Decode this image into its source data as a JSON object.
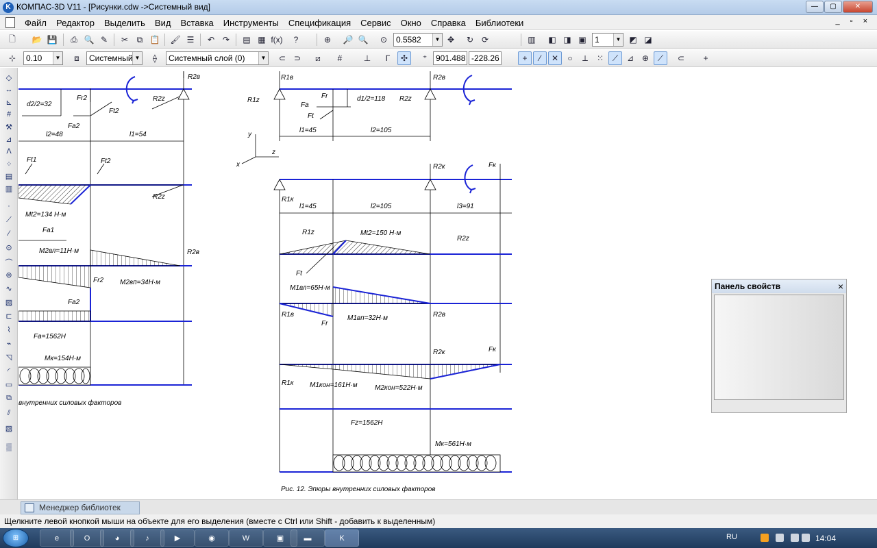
{
  "window": {
    "title": "КОМПАС-3D V11 - [Рисунки.cdw ->Системный вид]",
    "app_icon": "kompas-logo-icon",
    "controls": [
      "minimize-icon",
      "maximize-icon",
      "close-icon"
    ]
  },
  "menu": {
    "items": [
      "Файл",
      "Редактор",
      "Выделить",
      "Вид",
      "Вставка",
      "Инструменты",
      "Спецификация",
      "Сервис",
      "Окно",
      "Справка",
      "Библиотеки"
    ],
    "doc_controls": "_ ▫ ×"
  },
  "toolbar1": {
    "zoom_value": "0.5582",
    "layer_num": "1"
  },
  "toolbar2": {
    "step_value": "0.10",
    "view_select": "Системный",
    "layer_select": "Системный слой (0)",
    "coord_x": "901.488",
    "coord_y": "-228.26"
  },
  "drawing": {
    "caption": "Рис. 12. Эпюры внутренних силовых факторов",
    "caption_left": "внутренних силовых факторов",
    "labels_left": {
      "R2b": "R2в",
      "Fr2": "Fr2",
      "Ft2": "Ft2",
      "R2z": "R2z",
      "d2": "d2/2=32",
      "Fa2": "Fa2",
      "l2": "l2=48",
      "l1": "l1=54",
      "Ft1": "Ft1",
      "Ft2b": "Ft2",
      "R2z2": "R2z",
      "Mt2": "Mt2=134 Н·м",
      "Fa1": "Fa1",
      "M2bl": "M2вл=11Н·м",
      "R2b2": "R2в",
      "Fr2b": "Fr2",
      "M2bp": "M2вп=34Н·м",
      "Fa2b": "Fa2",
      "Fa": "Fa=1562Н",
      "Mk": "Mк=154Н·м"
    },
    "labels_right": {
      "R1b": "R1в",
      "R2b": "R2в",
      "R1z": "R1z",
      "Fr": "Fr",
      "d1": "d1/2=118",
      "Fa": "Fa",
      "R2z": "R2z",
      "Ft": "Ft",
      "l1": "l1=45",
      "l2": "l2=105",
      "y": "y",
      "z": "z",
      "x": "x",
      "R2k": "R2к",
      "Fk": "Fк",
      "R1k": "R1к",
      "l1b": "l1=45",
      "l2b": "l2=105",
      "l3": "l3=91",
      "R1z2": "R1z",
      "Mt2": "Mt2=150 Н·м",
      "R2z2": "R2z",
      "Ft2": "Ft",
      "M1bl": "M1вл=65Н·м",
      "R1b2": "R1в",
      "M1bp": "M1вп=32Н·м",
      "R2b2": "R2в",
      "Fr2": "Fr",
      "R2k2": "R2к",
      "Fk2": "Fк",
      "R1k2": "R1к",
      "M1kon": "M1кон=161Н·м",
      "M2kon": "M2кон=522Н·м",
      "Fz": "Fz=1562Н",
      "Mk": "Mк=561Н·м"
    }
  },
  "prop_panel": {
    "title": "Панель свойств",
    "close": "×"
  },
  "library": {
    "tab_label": "Менеджер библиотек"
  },
  "status": {
    "text": "Щелкните левой кнопкой мыши на объекте для его выделения (вместе с Ctrl или Shift - добавить к выделенным)"
  },
  "taskbar": {
    "lang": "RU",
    "time": "14:04",
    "tasks": [
      "ie-icon",
      "opera-icon",
      "firefox-icon",
      "media-icon",
      "player-icon",
      "chrome-icon",
      "word-icon",
      "image-icon",
      "folder-icon",
      "kompas-icon"
    ]
  }
}
